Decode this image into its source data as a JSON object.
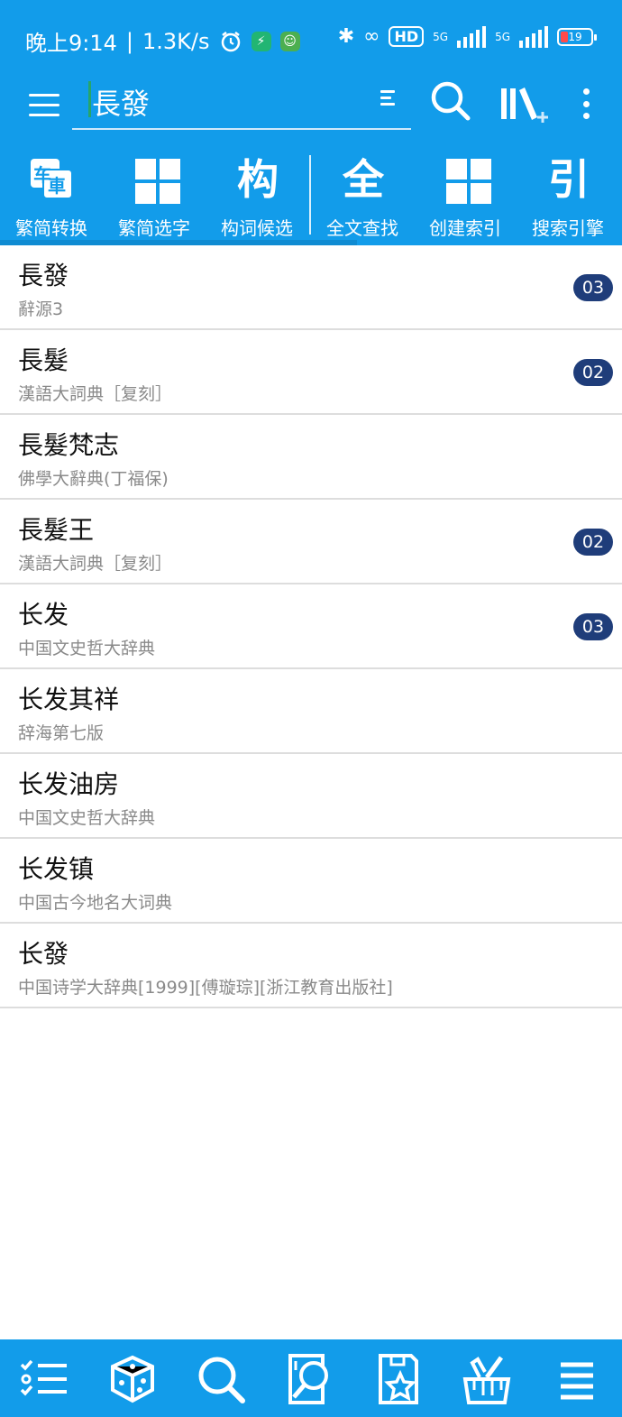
{
  "status": {
    "time": "晚上9:14",
    "speed": "1.3K/s",
    "hd": "HD",
    "net1": "5G",
    "net2": "5G",
    "battery": "19"
  },
  "search": {
    "query": "長發"
  },
  "tools": [
    {
      "glyph": "车車",
      "label": "繁简转换",
      "icon": "convert-icon"
    },
    {
      "glyph": "",
      "label": "繁简选字",
      "icon": "grid-icon"
    },
    {
      "glyph": "构",
      "label": "构词候选",
      "icon": "compose-icon"
    },
    {
      "glyph": "全",
      "label": "全文查找",
      "icon": "fulltext-icon"
    },
    {
      "glyph": "",
      "label": "创建索引",
      "icon": "grid-icon"
    },
    {
      "glyph": "引",
      "label": "搜索引擎",
      "icon": "engine-icon"
    }
  ],
  "results": [
    {
      "word": "長發",
      "source": "辭源3",
      "count": "03"
    },
    {
      "word": "長髮",
      "source": "漢語大詞典［复刻］",
      "count": "02"
    },
    {
      "word": "長髮梵志",
      "source": "佛學大辭典(丁福保)",
      "count": ""
    },
    {
      "word": "長髮王",
      "source": "漢語大詞典［复刻］",
      "count": "02"
    },
    {
      "word": "长发",
      "source": "中国文史哲大辞典",
      "count": "03"
    },
    {
      "word": "长发其祥",
      "source": "辞海第七版",
      "count": ""
    },
    {
      "word": "长发油房",
      "source": "中国文史哲大辞典",
      "count": ""
    },
    {
      "word": "长发镇",
      "source": "中国古今地名大词典",
      "count": ""
    },
    {
      "word": "长發",
      "source": "中国诗学大辞典[1999][傅璇琮][浙江教育出版社]",
      "count": ""
    }
  ],
  "colors": {
    "accent": "#129cea",
    "badge": "#1f3d7a"
  }
}
